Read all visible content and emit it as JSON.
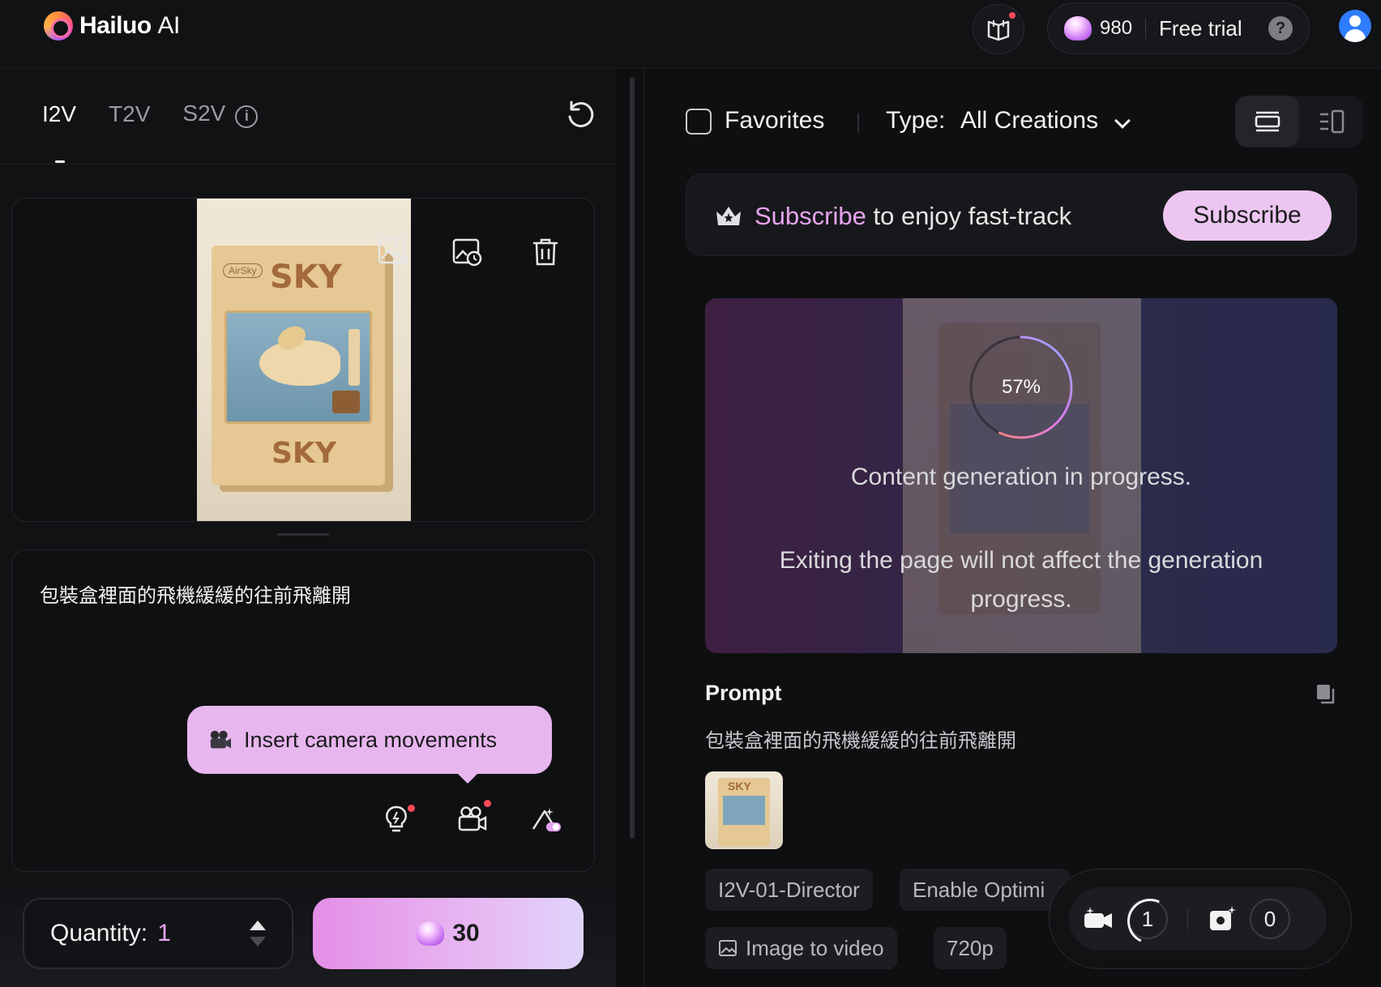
{
  "header": {
    "brand_bold": "Hailuo",
    "brand_light": "AI",
    "credits": "980",
    "plan_label": "Free trial",
    "help_symbol": "?"
  },
  "left": {
    "tabs": [
      {
        "label": "I2V",
        "active": true
      },
      {
        "label": "T2V",
        "active": false
      },
      {
        "label": "S2V",
        "active": false
      }
    ],
    "s2v_info_symbol": "i",
    "image_preview": {
      "brand": "AirSky",
      "top_text": "SKY",
      "bottom_text": "SKY"
    },
    "prompt_text": "包裝盒裡面的飛機緩緩的往前飛離開",
    "tooltip": "Insert camera movements",
    "quantity_label": "Quantity:",
    "quantity_value": "1",
    "generate_cost": "30"
  },
  "right": {
    "favorites_label": "Favorites",
    "type_label": "Type:",
    "type_value": "All Creations",
    "banner_highlight": "Subscribe",
    "banner_rest": " to enjoy fast-track",
    "subscribe_button": "Subscribe",
    "progress_percent": 57,
    "progress_text": "57%",
    "status_text": "Content generation in progress.",
    "note_text": "Exiting the page will not affect the generation progress.",
    "prompt_heading": "Prompt",
    "prompt_value": "包裝盒裡面的飛機緩緩的往前飛離開",
    "thumb_text": "SKY",
    "tags": {
      "model": "I2V-01-Director",
      "optimize": "Enable Optimi",
      "mode": "Image to video",
      "resolution": "720p"
    },
    "queue": {
      "video_count": "1",
      "image_count": "0"
    }
  },
  "colors": {
    "accent_pink": "#e7a3f0",
    "background": "#0e0f11",
    "panel": "#111214",
    "avatar_blue": "#2f7dff",
    "notification_red": "#ff4a5a"
  }
}
